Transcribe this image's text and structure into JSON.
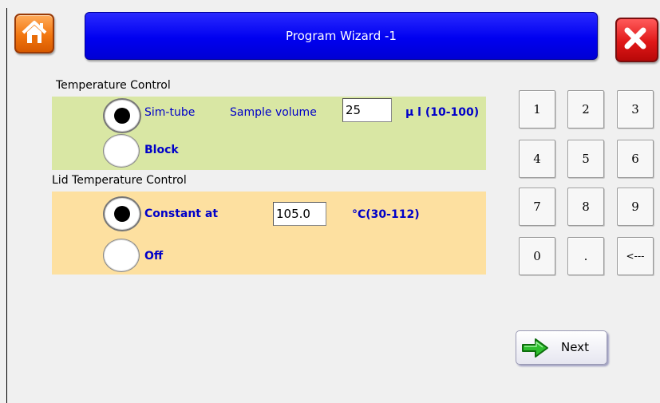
{
  "header": {
    "title": "Program Wizard -1",
    "home_icon": "home-icon",
    "close_icon": "close-icon"
  },
  "temperature_control": {
    "label": "Temperature Control",
    "option_simtube": "Sim-tube",
    "option_block": "Block",
    "selected": "Sim-tube",
    "sample_volume_label": "Sample volume",
    "sample_volume_value": "25",
    "sample_volume_unit": "μ l (10-100)"
  },
  "lid_temperature_control": {
    "label": "Lid Temperature Control",
    "option_constant": "Constant at",
    "option_off": "Off",
    "selected": "Constant at",
    "lid_temp_value": "105.0",
    "lid_temp_unit": "°C(30-112)"
  },
  "keypad": {
    "keys": [
      "1",
      "2",
      "3",
      "4",
      "5",
      "6",
      "7",
      "8",
      "9",
      "0",
      ".",
      "<---"
    ]
  },
  "footer": {
    "next_label": "Next",
    "next_icon": "arrow-right-icon"
  },
  "colors": {
    "title_bar": "#0000f0",
    "home_button": "#f2760f",
    "close_button": "#e01818",
    "temperature_panel": "#d9e7a4",
    "lid_panel": "#fde0a0",
    "option_text": "#0000c8"
  }
}
